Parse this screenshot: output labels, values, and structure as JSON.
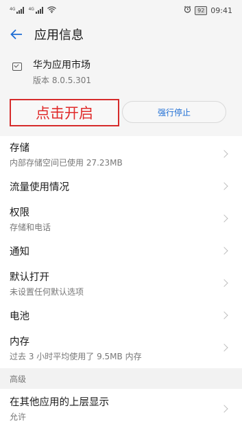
{
  "status_bar": {
    "sim1_label": "4G",
    "sim2_label": "4G",
    "battery": "92",
    "time": "09:41"
  },
  "header": {
    "title": "应用信息"
  },
  "app": {
    "name": "华为应用市场",
    "version": "版本 8.0.5.301"
  },
  "actions": {
    "open_label": "点击开启",
    "force_stop_label": "强行停止"
  },
  "settings": [
    {
      "title": "存储",
      "subtitle": "内部存储空间已使用 27.23MB"
    },
    {
      "title": "流量使用情况"
    },
    {
      "title": "权限",
      "subtitle": "存储和电话"
    },
    {
      "title": "通知"
    },
    {
      "title": "默认打开",
      "subtitle": "未设置任何默认选项"
    },
    {
      "title": "电池"
    },
    {
      "title": "内存",
      "subtitle": "过去 3 小时平均使用了 9.5MB 内存"
    }
  ],
  "advanced": {
    "section_label": "高级",
    "item_title": "在其他应用的上层显示",
    "item_subtitle": "允许"
  },
  "colors": {
    "accent": "#1f6ed4",
    "highlight": "#e02a2a"
  }
}
